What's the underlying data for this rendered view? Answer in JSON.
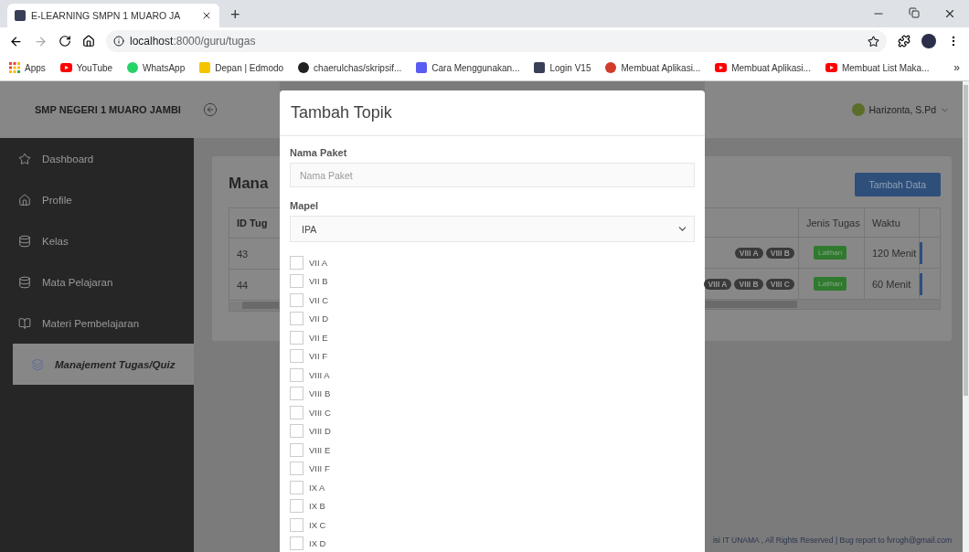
{
  "browser": {
    "tab_title": "E-LEARNING SMPN 1 MUARO JA",
    "new_tab": "+",
    "url_host": "localhost",
    "url_path": ":8000/guru/tugas",
    "bookmarks": [
      {
        "label": "Apps",
        "kind": "apps"
      },
      {
        "label": "YouTube",
        "kind": "youtube"
      },
      {
        "label": "WhatsApp",
        "kind": "whatsapp"
      },
      {
        "label": "Depan | Edmodo",
        "kind": "edmodo"
      },
      {
        "label": "chaerulchas/skripsif...",
        "kind": "github"
      },
      {
        "label": "Cara Menggunakan...",
        "kind": "wave"
      },
      {
        "label": "Login V15",
        "kind": "leaf"
      },
      {
        "label": "Membuat Aplikasi...",
        "kind": "circle"
      },
      {
        "label": "Membuat Aplikasi...",
        "kind": "youtube"
      },
      {
        "label": "Membuat List Maka...",
        "kind": "youtube"
      }
    ],
    "more": "»"
  },
  "brand": "SMP NEGERI 1 MUARO JAMBI",
  "user": "Harizonta, S.Pd",
  "sidebar": [
    {
      "label": "Dashboard",
      "kind": "star",
      "selected": false
    },
    {
      "label": "Profile",
      "kind": "home",
      "selected": false
    },
    {
      "label": "Kelas",
      "kind": "database",
      "selected": false
    },
    {
      "label": "Mata Pelajaran",
      "kind": "database",
      "selected": false
    },
    {
      "label": "Materi Pembelajaran",
      "kind": "book",
      "selected": false
    },
    {
      "label": "Manajement Tugas/Quiz",
      "kind": "layers",
      "selected": true
    }
  ],
  "card": {
    "heading": "Mana",
    "add_button": "Tambah Data",
    "left_columns": [
      "ID Tug"
    ],
    "right_columns": [
      "Jenis Tugas",
      "Waktu"
    ],
    "rows": [
      {
        "id": "43",
        "classes": [
          "VIII A",
          "VIII B"
        ],
        "type": "Latihan",
        "time": "120 Menit"
      },
      {
        "id": "44",
        "classes": [
          "VIII A",
          "VIII B",
          "VIII C"
        ],
        "type": "Latihan",
        "time": "60 Menit"
      }
    ]
  },
  "footer": "isi IT UNAMA , All Rights Reserved | Bug report to fvrogh@gmail.com",
  "modal": {
    "title": "Tambah Topik",
    "name_label": "Nama Paket",
    "name_placeholder": "Nama Paket",
    "subject_label": "Mapel",
    "subject_value": "IPA",
    "classes": [
      {
        "label": "VII A",
        "checked": false
      },
      {
        "label": "VII B",
        "checked": false
      },
      {
        "label": "VII C",
        "checked": false
      },
      {
        "label": "VII D",
        "checked": false
      },
      {
        "label": "VII E",
        "checked": false
      },
      {
        "label": "VII F",
        "checked": false
      },
      {
        "label": "VIII A",
        "checked": false
      },
      {
        "label": "VIII B",
        "checked": false
      },
      {
        "label": "VIII C",
        "checked": false
      },
      {
        "label": "VIII D",
        "checked": false
      },
      {
        "label": "VIII E",
        "checked": false
      },
      {
        "label": "VIII F",
        "checked": false
      },
      {
        "label": "IX A",
        "checked": false
      },
      {
        "label": "IX B",
        "checked": false
      },
      {
        "label": "IX C",
        "checked": false
      },
      {
        "label": "IX D",
        "checked": false
      }
    ]
  }
}
